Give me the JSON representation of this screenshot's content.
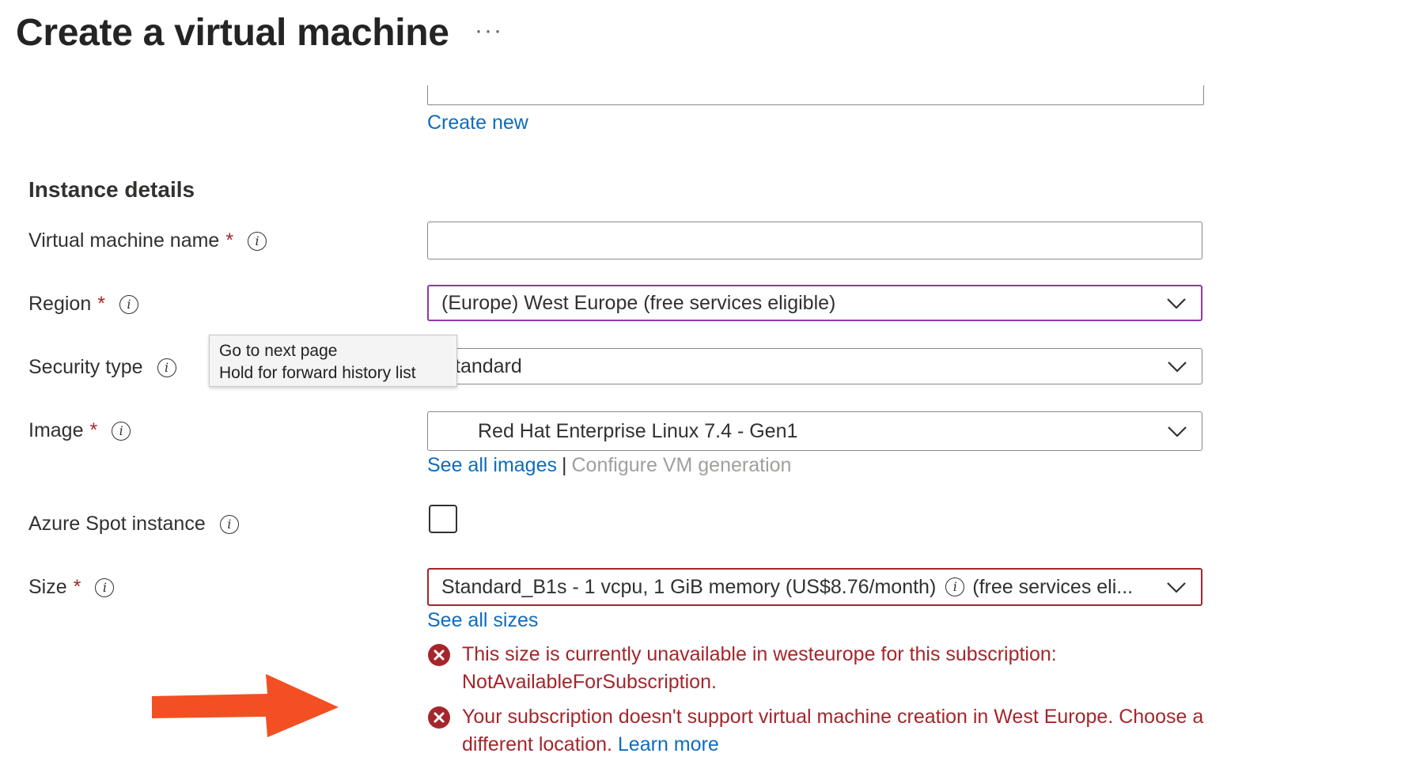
{
  "header": {
    "title": "Create a virtual machine",
    "more_label": "···"
  },
  "links": {
    "create_new": "Create new"
  },
  "section": {
    "title": "Instance details"
  },
  "fields": {
    "vm_name": {
      "label": "Virtual machine name",
      "required_mark": "*",
      "value": ""
    },
    "region": {
      "label": "Region",
      "required_mark": "*",
      "value": "(Europe) West Europe (free services eligible)"
    },
    "security_type": {
      "label": "Security type",
      "value": "Standard",
      "visible_value": "tandard"
    },
    "image": {
      "label": "Image",
      "required_mark": "*",
      "value": "Red Hat Enterprise Linux 7.4 - Gen1",
      "see_all_images": "See all images",
      "separator": "|",
      "configure_generation": "Configure VM generation"
    },
    "spot": {
      "label": "Azure Spot instance",
      "checked": false
    },
    "size": {
      "label": "Size",
      "required_mark": "*",
      "value_main": "Standard_B1s - 1 vcpu, 1 GiB memory (US$8.76/month)",
      "value_suffix": "(free services eli...",
      "see_all_sizes": "See all sizes"
    }
  },
  "tooltip": {
    "line1": "Go to next page",
    "line2": "Hold for forward history list"
  },
  "errors": [
    {
      "text": "This size is currently unavailable in westeurope for this subscription: NotAvailableForSubscription."
    },
    {
      "text": "Your subscription doesn't support virtual machine creation in West Europe. Choose a different location.",
      "link": "Learn more"
    }
  ],
  "colors": {
    "link": "#0f6cbd",
    "error": "#a4262c",
    "focus": "#8a3aa8",
    "annotation_arrow": "#f25022"
  },
  "icons": {
    "info": "info-icon",
    "chevron": "chevron-down-icon",
    "error": "error-circle-icon",
    "annotation": "arrow-right-icon"
  }
}
